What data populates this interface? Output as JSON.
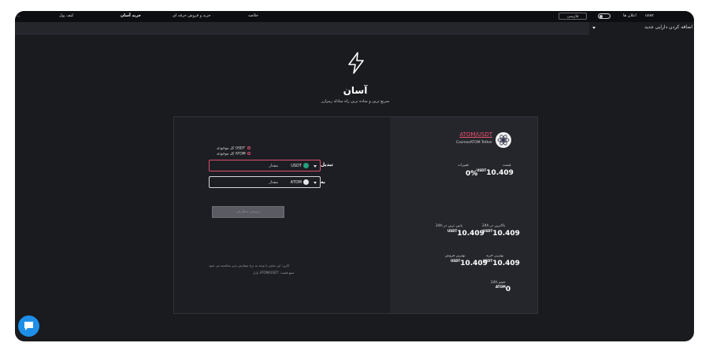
{
  "topbar": {
    "logo": "...",
    "wallet": "کیف پول",
    "easy_buy": "خرید آسان",
    "pro_trade": "خرید و فروش حرفه ای",
    "summary": "خلاصه",
    "language": "فارسی",
    "notifications": "اعلان ها",
    "user": "user"
  },
  "sidebar": {
    "add_asset": "اضافه کردن دارایی جدید"
  },
  "hero": {
    "title": "آسان",
    "subtitle": "سریع ترین و ساده ترین راه مبادله رمزارز"
  },
  "market": {
    "pair": "ATOM/USDT",
    "pair_sub": "CosmosATOM Tether",
    "price_label": "قیمت",
    "price": "10.409",
    "price_unit": "USDT",
    "change_label": "تغییرات",
    "change": "0%",
    "high_label": "بالاترین در 24h",
    "high": "10.409",
    "low_label": "پایین ترین در 24h",
    "low": "10.409",
    "unit": "USDT",
    "best_buy_label": "بهترین خرید",
    "best_buy": "10.409",
    "best_sell_label": "بهترین فروش",
    "best_sell": "10.409",
    "volume_label": "حجم 24h",
    "volume": "0",
    "volume_unit": "ATOM"
  },
  "form": {
    "balance_usdt": "USDT کل موجودی",
    "balance_atom": "ATOM کل موجودی",
    "convert_label": "تبدیل",
    "to_label": "به",
    "from_coin": "USDT",
    "to_coin": "ATOM",
    "amount_placeholder": "مقدار",
    "submit_button": "بررسی سفارش",
    "note_line1": "کاربر: این بخش با توجه به نرخ سفارش پذیر محاسبه می شود",
    "note_line2": "منبع قیمت: ATOM/USDT بازار"
  },
  "colors": {
    "accent": "#e0506e",
    "usdt": "#26a17b",
    "chat": "#1e8fe8"
  }
}
